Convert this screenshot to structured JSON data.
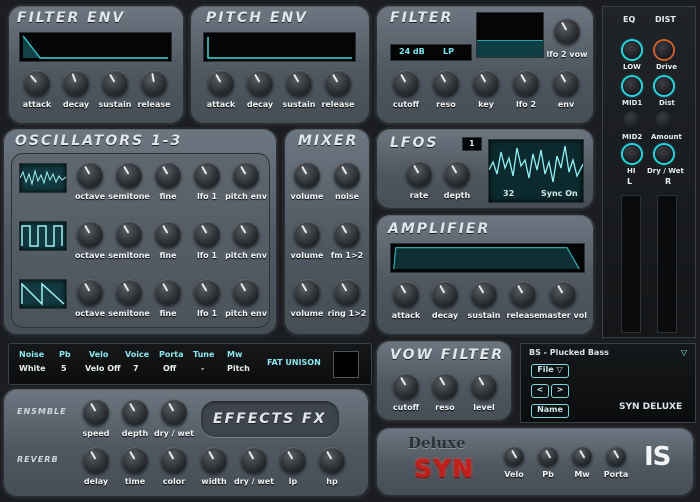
{
  "filter_env": {
    "title": "FILTER ENV",
    "knobs": [
      "attack",
      "decay",
      "sustain",
      "release"
    ]
  },
  "pitch_env": {
    "title": "PITCH ENV",
    "knobs": [
      "attack",
      "decay",
      "sustain",
      "release"
    ]
  },
  "filter": {
    "title": "FILTER",
    "slope": "24 dB",
    "type": "LP",
    "lfo2vow": "lfo 2 vow",
    "knobs": [
      "cutoff",
      "reso",
      "key",
      "lfo 2",
      "env"
    ]
  },
  "oscillators": {
    "title": "OSCILLATORS 1-3",
    "row_knobs": [
      "octave",
      "semitone",
      "fine",
      "lfo 1",
      "pitch env"
    ]
  },
  "mixer": {
    "title": "MIXER",
    "rows": [
      [
        "volume",
        "noise"
      ],
      [
        "volume",
        "fm 1>2"
      ],
      [
        "volume",
        "ring 1>2"
      ]
    ]
  },
  "lfos": {
    "title": "LFOS",
    "index": "1",
    "rate": "rate",
    "depth": "depth",
    "value": "32",
    "sync": "Sync On"
  },
  "amplifier": {
    "title": "AMPLIFIER",
    "knobs": [
      "attack",
      "decay",
      "sustain",
      "release",
      "master vol"
    ]
  },
  "eq": {
    "eq_label": "EQ",
    "dist_label": "DIST",
    "left": [
      "LOW",
      "MID1",
      "MID2",
      "HI"
    ],
    "right": [
      "Drive",
      "Dist",
      "Amount",
      "Dry / Wet"
    ],
    "l": "L",
    "r": "R"
  },
  "status": {
    "headers": [
      "Noise",
      "Pb",
      "Velo",
      "Voice",
      "Porta",
      "Tune",
      "Mw"
    ],
    "values": [
      "White",
      "5",
      "Velo Off",
      "7",
      "Off",
      "-",
      "Pitch"
    ],
    "unison": "FAT UNISON"
  },
  "vow_filter": {
    "title": "VOW FILTER",
    "knobs": [
      "cutoff",
      "reso",
      "level"
    ]
  },
  "preset": {
    "name": "BS - Plucked Bass",
    "file": "File",
    "prev": "<",
    "next": ">",
    "name_btn": "Name",
    "brand": "SYN DELUXE"
  },
  "effects": {
    "title": "EFFECTS FX",
    "ensemble": "ENSMBLE",
    "reverb": "REVERB",
    "ens_knobs": [
      "speed",
      "depth",
      "dry / wet"
    ],
    "rev_knobs": [
      "delay",
      "time",
      "color",
      "width",
      "dry / wet",
      "lp",
      "hp"
    ]
  },
  "logo": {
    "deluxe": "Deluxe",
    "syn": "SYN",
    "mark": "IS",
    "knobs": [
      "Velo",
      "Pb",
      "Mw",
      "Porta"
    ]
  },
  "accent": "#27d3df"
}
